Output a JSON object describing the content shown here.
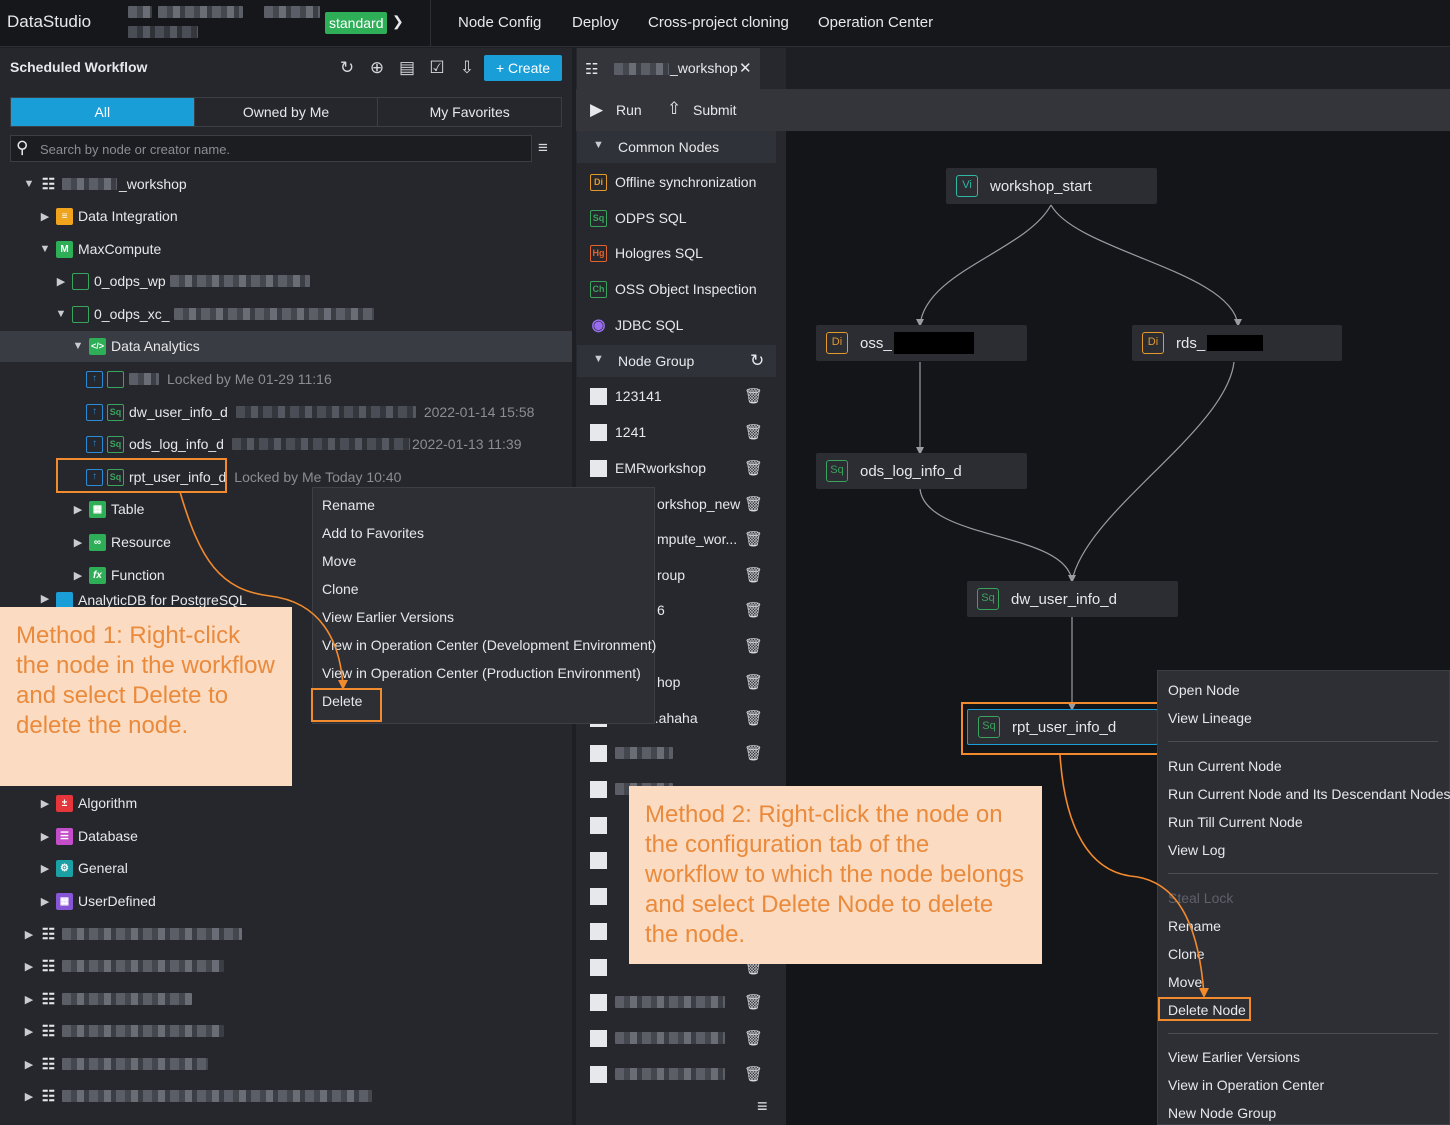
{
  "app": {
    "title": "DataStudio",
    "environment": "standard"
  },
  "topnav": [
    "Node Config",
    "Deploy",
    "Cross-project cloning",
    "Operation Center"
  ],
  "left": {
    "title": "Scheduled Workflow",
    "create_label": "+ Create",
    "tabs": [
      "All",
      "Owned by Me",
      "My Favorites"
    ],
    "search_placeholder": "Search by node or creator name.",
    "tree": {
      "workflow": "_workshop",
      "data_integration": "Data Integration",
      "maxcompute": "MaxCompute",
      "odps_wp": "0_odps_wp",
      "odps_xc": "0_odps_xc_",
      "data_analytics": "Data Analytics",
      "node1_meta": "Locked by Me   01-29 11:16",
      "node2": "dw_user_info_d",
      "node2_date": "2022-01-14 15:58",
      "node3": "ods_log_info_d",
      "node3_date": "2022-01-13 11:39",
      "node4": "rpt_user_info_d",
      "node4_meta": "Locked by Me  Today 10:40",
      "table": "Table",
      "resource": "Resource",
      "function": "Function",
      "adb": "AnalyticDB for PostgreSQL",
      "algorithm": "Algorithm",
      "database": "Database",
      "general": "General",
      "userdefined": "UserDefined"
    },
    "context_menu": [
      "Rename",
      "Add to Favorites",
      "Move",
      "Clone",
      "View Earlier Versions",
      "View in Operation Center (Development Environment)",
      "View in Operation Center (Production Environment)",
      "Delete"
    ]
  },
  "middle": {
    "file_tab": "_workshop",
    "run_label": "Run",
    "submit_label": "Submit",
    "common_nodes_label": "Common Nodes",
    "common_nodes": [
      {
        "label": "Offline synchronization",
        "icon": "Di"
      },
      {
        "label": "ODPS SQL",
        "icon": "Sq"
      },
      {
        "label": "Hologres SQL",
        "icon": "Hg"
      },
      {
        "label": "OSS Object Inspection",
        "icon": "Ch"
      },
      {
        "label": "JDBC SQL",
        "icon": "jdbc-icon"
      }
    ],
    "node_group_label": "Node Group",
    "groups": [
      "123141",
      "1241",
      "EMRworkshop",
      "orkshop_new",
      "mpute_wor...",
      "roup",
      "6",
      "",
      "hop",
      "...ahaha"
    ]
  },
  "graph": {
    "nodes": {
      "start": "workshop_start",
      "oss": "oss_",
      "rds": "rds_",
      "ods": "ods_log_info_d",
      "dw": "dw_user_info_d",
      "rpt": "rpt_user_info_d"
    },
    "context_menu": {
      "group1": [
        "Open Node",
        "View Lineage"
      ],
      "group2": [
        "Run Current Node",
        "Run Current Node and Its Descendant Nodes",
        "Run Till Current Node",
        "View Log"
      ],
      "steal_lock": "Steal Lock",
      "group3": [
        "Rename",
        "Clone",
        "Move",
        "Delete Node"
      ],
      "group4": [
        "View Earlier Versions",
        "View in Operation Center",
        "New Node Group"
      ]
    }
  },
  "annotations": {
    "method1": "Method 1: Right-click the node in the workflow and select Delete to delete the node.",
    "method2": "Method 2: Right-click the node on the configuration tab of the workflow to which the node belongs and select Delete Node to delete the node."
  },
  "colors": {
    "accent": "#1a9ed8",
    "highlight": "#f28a2e",
    "callout_bg": "#fbdcc2",
    "env_badge": "#2fae58"
  }
}
